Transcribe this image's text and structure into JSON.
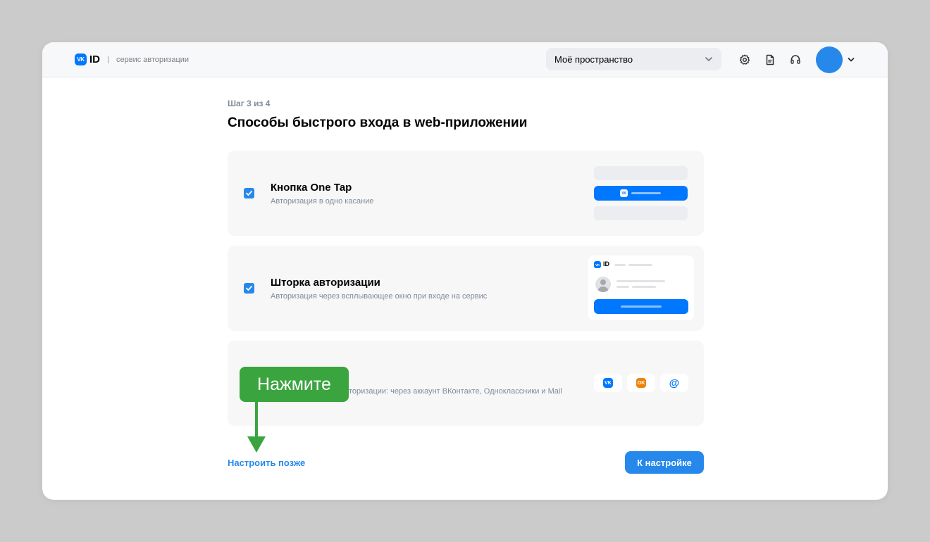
{
  "header": {
    "logo_id": "ID",
    "logo_vk": "VK",
    "service_label": "сервис авторизации",
    "space_select_value": "Моё пространство"
  },
  "page": {
    "step": "Шаг 3 из 4",
    "title": "Способы быстрого входа в web-приложении"
  },
  "cards": [
    {
      "title": "Кнопка One Tap",
      "subtitle": "Авторизация в одно касание",
      "checked": true
    },
    {
      "title": "Шторка авторизации",
      "subtitle": "Авторизация через всплывающее окно при входе на сервис",
      "checked": true
    },
    {
      "title": "",
      "subtitle": "торизации: через аккаунт ВКонтакте, Одноклассники и Mail",
      "checked": false
    }
  ],
  "preview": {
    "vk_label": "VK",
    "id_label": "ID",
    "ok_label": "OK",
    "mail_label": "@"
  },
  "footer": {
    "later_link": "Настроить позже",
    "next_button": "К настройке"
  },
  "annotation": {
    "tooltip": "Нажмите"
  },
  "colors": {
    "accent": "#2688eb",
    "vk_blue": "#0077ff",
    "ok_orange": "#ee8208",
    "annotation_green": "#3aa53f"
  },
  "icons": [
    "settings-icon",
    "document-icon",
    "support-headset-icon",
    "chevron-down-icon",
    "check-icon"
  ]
}
